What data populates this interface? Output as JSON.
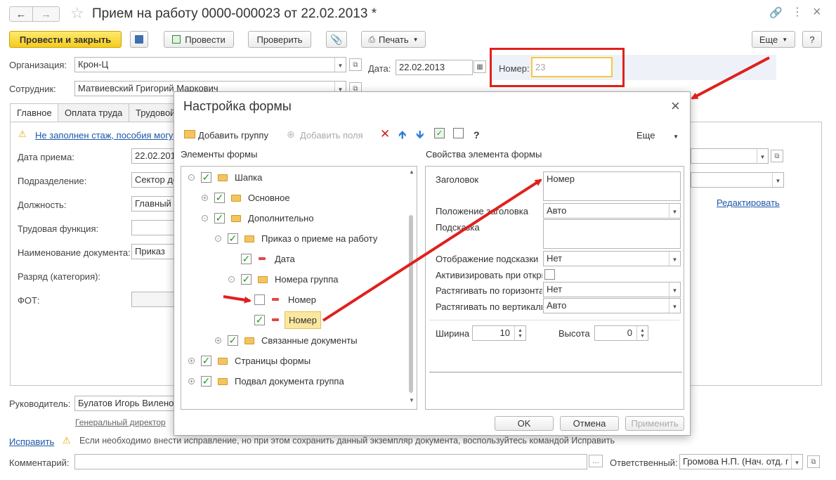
{
  "window": {
    "title": "Прием на работу 0000-000023 от 22.02.2013 *"
  },
  "toolbar": {
    "post_close": "Провести и закрыть",
    "post": "Провести",
    "check": "Проверить",
    "print": "Печать",
    "more": "Еще",
    "help": "?"
  },
  "header": {
    "org_label": "Организация:",
    "org_value": "Крон-Ц",
    "date_label": "Дата:",
    "date_value": "22.02.2013",
    "number_label": "Номер:",
    "number_value": "23",
    "employee_label": "Сотрудник:",
    "employee_value": "Матвиевский Григорий Маркович"
  },
  "tabs": [
    "Главное",
    "Оплата труда",
    "Трудовой"
  ],
  "main": {
    "warning": "Не заполнен стаж, пособия могу",
    "rows": [
      {
        "label": "Дата приема:",
        "value": "22.02.201"
      },
      {
        "label": "Подразделение:",
        "value": "Сектор до"
      },
      {
        "label": "Должность:",
        "value": "Главный"
      },
      {
        "label": "Трудовая функция:",
        "value": ""
      },
      {
        "label": "Наименование документа:",
        "value": "Приказ"
      },
      {
        "label": "Разряд (категория):",
        "value": ""
      },
      {
        "label": "ФОТ:",
        "value": ""
      }
    ],
    "edit_link": "Редактировать"
  },
  "footer": {
    "head_label": "Руководитель:",
    "head_value": "Булатов Игорь Виленович",
    "head_position": "Генеральный директор",
    "fix_link": "Исправить",
    "fix_hint": "Если необходимо внести исправление, но при этом сохранить данный экземпляр документа, воспользуйтесь командой Исправить",
    "comment_label": "Комментарий:",
    "responsible_label": "Ответственный:",
    "responsible_value": "Громова Н.П. (Нач. отд. пе"
  },
  "dialog": {
    "title": "Настройка формы",
    "add_group": "Добавить группу",
    "add_fields": "Добавить поля",
    "more": "Еще",
    "help": "?",
    "elements_title": "Элементы формы",
    "properties_title": "Свойства элемента формы",
    "tree": [
      {
        "label": "Шапка"
      },
      {
        "label": "Основное"
      },
      {
        "label": "Дополнительно"
      },
      {
        "label": "Приказ о приеме на работу"
      },
      {
        "label": "Дата"
      },
      {
        "label": "Номера группа"
      },
      {
        "label": "Номер"
      },
      {
        "label": "Номер"
      },
      {
        "label": "Связанные документы"
      },
      {
        "label": "Страницы формы"
      },
      {
        "label": "Подвал документа группа"
      }
    ],
    "props": {
      "caption_label": "Заголовок",
      "caption_value": "Номер",
      "caption_pos_label": "Положение заголовка",
      "caption_pos_value": "Авто",
      "hint_label": "Подсказка",
      "hint_display_label": "Отображение подсказки",
      "hint_display_value": "Нет",
      "activate_label": "Активизировать при открытии",
      "stretch_h_label": "Растягивать по горизонтали",
      "stretch_h_value": "Нет",
      "stretch_v_label": "Растягивать по вертикали",
      "stretch_v_value": "Авто",
      "width_label": "Ширина",
      "width_value": "10",
      "height_label": "Высота",
      "height_value": "0"
    },
    "ok": "OK",
    "cancel": "Отмена",
    "apply": "Применить"
  },
  "colors": {
    "accent_yellow": "#f5cc1b",
    "highlight_red": "#e0201e",
    "check_green": "#1b9b1b",
    "link_blue": "#1c57a8"
  }
}
